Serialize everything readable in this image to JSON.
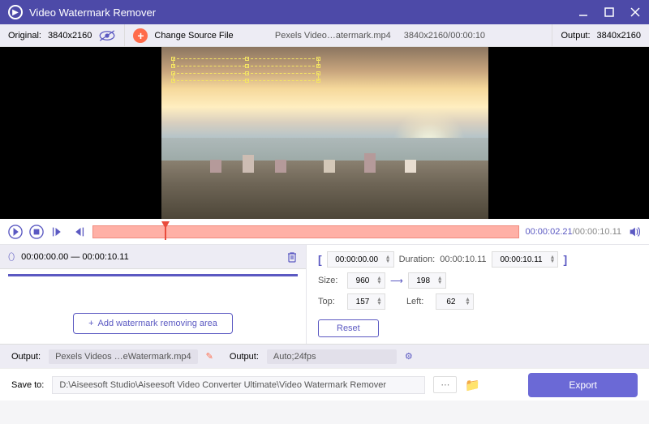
{
  "titlebar": {
    "title": "Video Watermark Remover"
  },
  "header": {
    "original_label": "Original:",
    "original_res": "3840x2160",
    "change_source": "Change Source File",
    "filename": "Pexels Video…atermark.mp4",
    "file_res_time": "3840x2160/00:00:10",
    "output_label": "Output:",
    "output_res": "3840x2160"
  },
  "player": {
    "time_current": "00:00:02.21",
    "time_total": "/00:00:10.11"
  },
  "area": {
    "range": "00:00:00.00 — 00:00:10.11",
    "add_button": "Add watermark removing area"
  },
  "props": {
    "start": "00:00:00.00",
    "duration_label": "Duration:",
    "duration": "00:00:10.11",
    "end": "00:00:10.11",
    "size_label": "Size:",
    "width": "960",
    "height": "198",
    "top_label": "Top:",
    "top": "157",
    "left_label": "Left:",
    "left": "62",
    "reset": "Reset"
  },
  "output": {
    "label1": "Output:",
    "filename": "Pexels Videos …eWatermark.mp4",
    "label2": "Output:",
    "format": "Auto;24fps"
  },
  "save": {
    "label": "Save to:",
    "path": "D:\\Aiseesoft Studio\\Aiseesoft Video Converter Ultimate\\Video Watermark Remover",
    "export": "Export"
  }
}
